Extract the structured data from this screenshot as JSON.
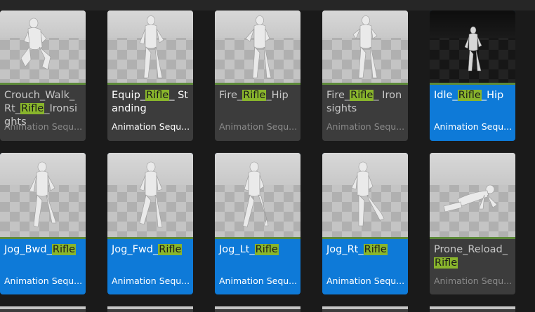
{
  "highlight_term": "Rifle",
  "accent_color": "#0e7ad8",
  "highlight_color": "#89b52c",
  "assets": [
    {
      "prefix": "Crouch_Walk_Rt_",
      "term": "Rifle",
      "suffix": "_Ironsights",
      "type": "Animation Sequ...",
      "selected": false
    },
    {
      "prefix": "Equip_",
      "term": "Rifle",
      "suffix": "_ Standing",
      "type": "Animation Sequ...",
      "selected": false
    },
    {
      "prefix": "Fire_",
      "term": "Rifle",
      "suffix": "_Hip",
      "type": "Animation Sequ...",
      "selected": false
    },
    {
      "prefix": "Fire_",
      "term": "Rifle",
      "suffix": "_ Ironsights",
      "type": "Animation Sequ...",
      "selected": false
    },
    {
      "prefix": "Idle_",
      "term": "Rifle",
      "suffix": "_Hip",
      "type": "Animation Sequ...",
      "selected": true
    },
    {
      "prefix": "Jog_Bwd_",
      "term": "Rifle",
      "suffix": "",
      "type": "Animation Sequ...",
      "selected": true
    },
    {
      "prefix": "Jog_Fwd_",
      "term": "Rifle",
      "suffix": "",
      "type": "Animation Sequ...",
      "selected": true
    },
    {
      "prefix": "Jog_Lt_",
      "term": "Rifle",
      "suffix": "",
      "type": "Animation Sequ...",
      "selected": true
    },
    {
      "prefix": "Jog_Rt_",
      "term": "Rifle",
      "suffix": "",
      "type": "Animation Sequ...",
      "selected": true
    },
    {
      "prefix": "Prone_Reload_",
      "term": "Rifle",
      "suffix": "",
      "type": "Animation Sequ...",
      "selected": false
    }
  ]
}
